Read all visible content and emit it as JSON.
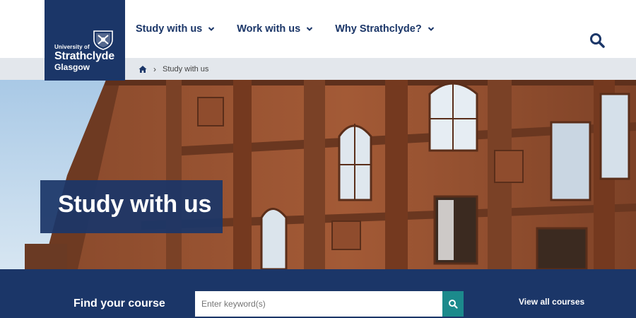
{
  "logo": {
    "line1": "University of",
    "line2": "Strathclyde",
    "line3": "Glasgow"
  },
  "nav": {
    "items": [
      {
        "label": "Study with us"
      },
      {
        "label": "Work with us"
      },
      {
        "label": "Why Strathclyde?"
      }
    ]
  },
  "breadcrumb": {
    "current": "Study with us"
  },
  "hero": {
    "title": "Study with us"
  },
  "find_course": {
    "label": "Find your course",
    "placeholder": "Enter keyword(s)",
    "view_all": "View all courses"
  },
  "colors": {
    "navy": "#1b3668",
    "teal": "#1c8a8c",
    "breadcrumb_bg": "#e3e7ec"
  }
}
